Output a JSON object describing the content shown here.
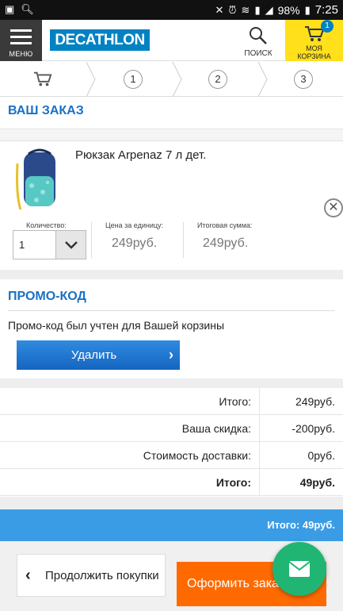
{
  "status_bar": {
    "battery": "98%",
    "time": "7:25"
  },
  "header": {
    "menu_label": "МЕНЮ",
    "logo_text": "DECATHLON",
    "search_label": "ПОИСК",
    "cart_label_line1": "МОЯ",
    "cart_label_line2": "КОРЗИНА",
    "cart_count": "1"
  },
  "steps": [
    {
      "label": "1"
    },
    {
      "label": "2"
    },
    {
      "label": "3"
    }
  ],
  "order": {
    "title": "ВАШ ЗАКАЗ",
    "product_name": "Рюкзак Arpenaz 7 л дет.",
    "quantity_label": "Количество:",
    "quantity_value": "1",
    "unit_price_label": "Цена за единицу:",
    "unit_price": "249руб.",
    "total_label": "Итоговая сумма:",
    "total": "249руб."
  },
  "promo": {
    "title": "ПРОМО-КОД",
    "message": "Промо-код был учтен для Вашей корзины",
    "delete_label": "Удалить"
  },
  "totals": [
    {
      "label": "Итого:",
      "value": "249руб."
    },
    {
      "label": "Ваша скидка:",
      "value": "-200руб."
    },
    {
      "label": "Стоимость доставки:",
      "value": "0руб."
    },
    {
      "label": "Итого:",
      "value": "49руб."
    }
  ],
  "summary_bar": "Итого: 49руб.",
  "buttons": {
    "continue_label": "Продолжить покупки",
    "checkout_label": "Оформить заказ"
  },
  "colors": {
    "brand_blue": "#0082c3",
    "accent_yellow": "#ffe01b",
    "title_blue": "#1a70c4",
    "checkout_orange": "#ff6a00",
    "fab_green": "#21b573"
  }
}
